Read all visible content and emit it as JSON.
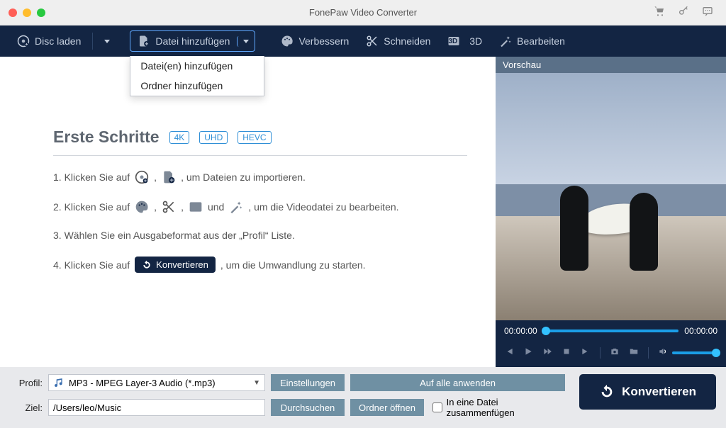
{
  "title": "FonePaw Video Converter",
  "toolbar": {
    "disc_load": "Disc laden",
    "add_file": "Datei hinzufügen",
    "enhance": "Verbessern",
    "cut": "Schneiden",
    "three_d": "3D",
    "edit": "Bearbeiten"
  },
  "dropdown": {
    "add_files": "Datei(en) hinzufügen",
    "add_folder": "Ordner hinzufügen"
  },
  "steps": {
    "heading": "Erste Schritte",
    "chips": [
      "4K",
      "UHD",
      "HEVC"
    ],
    "s1a": "1. Klicken Sie auf",
    "s1b": ", um Dateien zu importieren.",
    "s2a": "2. Klicken Sie auf",
    "s2and": "und",
    "s2b": ", um die Videodatei zu bearbeiten.",
    "s3": "3. Wählen Sie ein Ausgabeformat aus der „Profil“ Liste.",
    "s4a": "4. Klicken Sie auf",
    "s4btn": "Konvertieren",
    "s4b": ", um die Umwandlung zu starten."
  },
  "preview": {
    "header": "Vorschau",
    "t_start": "00:00:00",
    "t_end": "00:00:00"
  },
  "bottom": {
    "profile_lbl": "Profil:",
    "profile_val": "MP3 - MPEG Layer-3 Audio (*.mp3)",
    "settings": "Einstellungen",
    "apply_all": "Auf alle anwenden",
    "dest_lbl": "Ziel:",
    "dest_val": "/Users/leo/Music",
    "browse": "Durchsuchen",
    "open_folder": "Ordner öffnen",
    "merge": "In eine Datei zusammenfügen",
    "convert": "Konvertieren"
  }
}
